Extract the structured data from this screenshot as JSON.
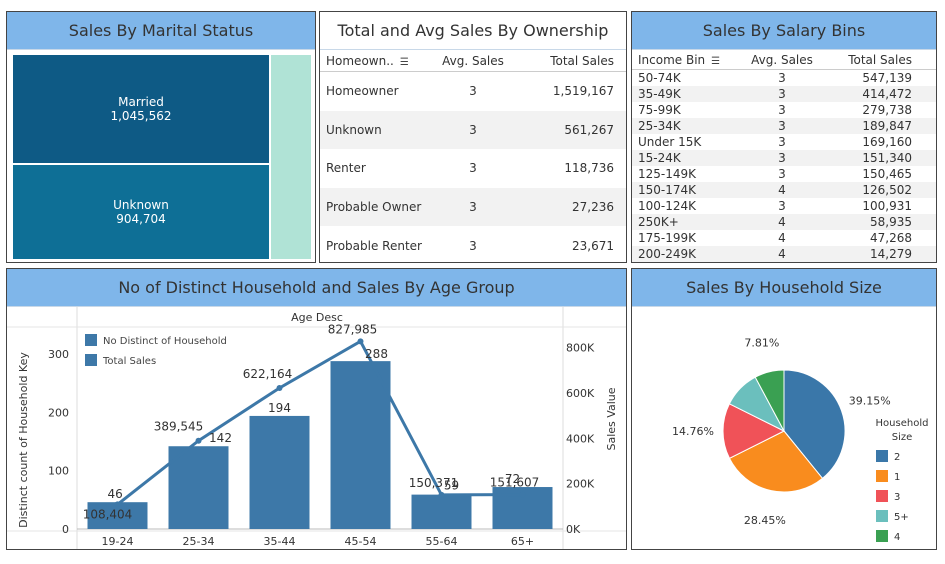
{
  "marital": {
    "title": "Sales By Marital Status",
    "blocks": [
      {
        "label": "Married",
        "value": "1,045,562",
        "color": "#0e5a85"
      },
      {
        "label": "Unknown",
        "value": "904,704",
        "color": "#0e6f96"
      }
    ],
    "side_color": "#b0e3d6"
  },
  "ownership": {
    "title": "Total and Avg Sales By Ownership",
    "headers": [
      "Homeown..",
      "Avg. Sales",
      "Total Sales"
    ],
    "rows": [
      [
        "Homeowner",
        "3",
        "1,519,167"
      ],
      [
        "Unknown",
        "3",
        "561,267"
      ],
      [
        "Renter",
        "3",
        "118,736"
      ],
      [
        "Probable Owner",
        "3",
        "27,236"
      ],
      [
        "Probable Renter",
        "3",
        "23,671"
      ]
    ]
  },
  "salary": {
    "title": "Sales By Salary Bins",
    "headers": [
      "Income Bin",
      "Avg. Sales",
      "Total Sales"
    ],
    "rows": [
      [
        "50-74K",
        "3",
        "547,139"
      ],
      [
        "35-49K",
        "3",
        "414,472"
      ],
      [
        "75-99K",
        "3",
        "279,738"
      ],
      [
        "25-34K",
        "3",
        "189,847"
      ],
      [
        "Under 15K",
        "3",
        "169,160"
      ],
      [
        "15-24K",
        "3",
        "151,340"
      ],
      [
        "125-149K",
        "3",
        "150,465"
      ],
      [
        "150-174K",
        "4",
        "126,502"
      ],
      [
        "100-124K",
        "3",
        "100,931"
      ],
      [
        "250K+",
        "4",
        "58,935"
      ],
      [
        "175-199K",
        "4",
        "47,268"
      ],
      [
        "200-249K",
        "4",
        "14,279"
      ]
    ]
  },
  "age": {
    "title": "No of Distinct Household and Sales By Age Group",
    "header": "Age Desc",
    "ylabel_left": "Distinct count of Household Key",
    "ylabel_right": "Sales Value",
    "legend": [
      "No Distinct of Household",
      "Total Sales"
    ]
  },
  "household": {
    "title": "Sales By Household Size",
    "legend_title": "Household Size"
  },
  "chart_data": [
    {
      "type": "bar",
      "categories": [
        "19-24",
        "25-34",
        "35-44",
        "45-54",
        "55-64",
        "65+"
      ],
      "series": [
        {
          "name": "No Distinct of Household",
          "type": "bar",
          "values": [
            46,
            142,
            194,
            288,
            59,
            72
          ],
          "labels": [
            "46",
            "142",
            "194",
            "288",
            "59",
            "72"
          ],
          "color": "#3d78a8"
        },
        {
          "name": "Total Sales",
          "type": "line",
          "values": [
            108404,
            389545,
            622164,
            827985,
            150371,
            151607
          ],
          "labels": [
            "108,404",
            "389,545",
            "622,164",
            "827,985",
            "150,371",
            "151,607"
          ],
          "color": "#3d78a8"
        }
      ],
      "y_left": {
        "ticks": [
          0,
          100,
          200,
          300
        ],
        "ylim": [
          0,
          350
        ]
      },
      "y_right": {
        "ticks": [
          "0K",
          "200K",
          "400K",
          "600K",
          "800K"
        ],
        "ylim": [
          0,
          900000
        ]
      }
    },
    {
      "type": "pie",
      "labels": [
        "2",
        "1",
        "3",
        "5+",
        "4"
      ],
      "values": [
        39.15,
        28.45,
        14.76,
        9.83,
        7.81
      ],
      "data_labels": [
        "39.15%",
        "28.45%",
        "14.76%",
        "",
        "7.81%"
      ],
      "colors": [
        "#3a77a9",
        "#f98c1e",
        "#f05258",
        "#6bbfbd",
        "#3aa052"
      ]
    }
  ]
}
